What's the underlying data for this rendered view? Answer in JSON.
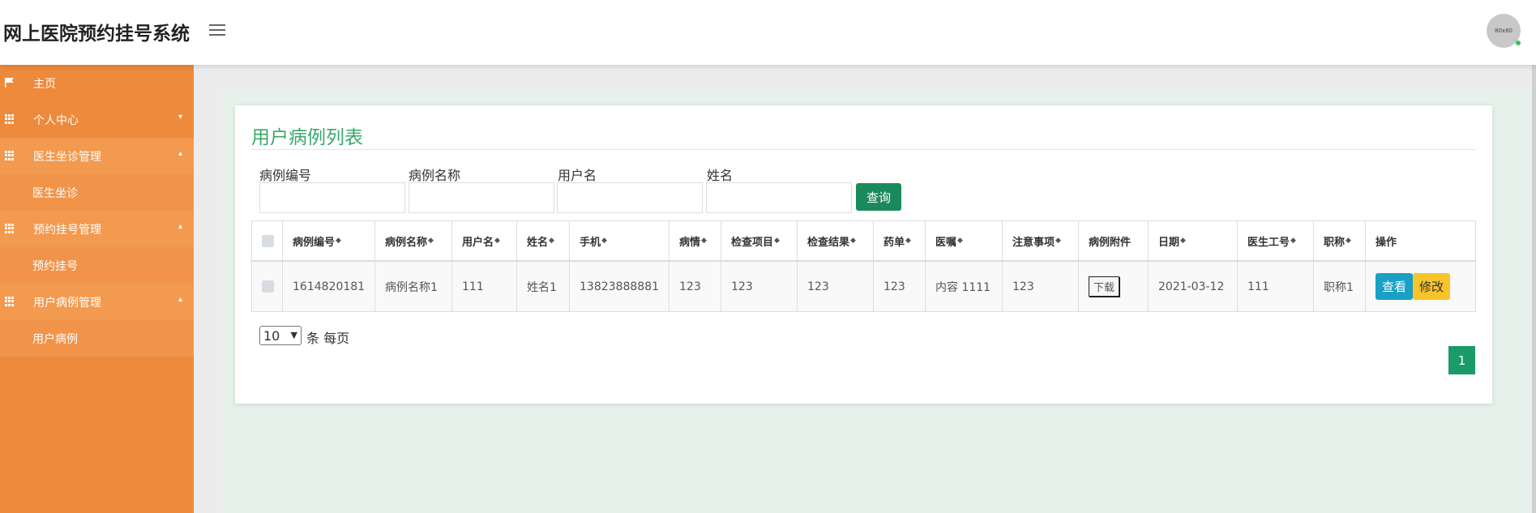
{
  "app": {
    "title": "网上医院预约挂号系统",
    "avatar_text": "80x80"
  },
  "sidebar": {
    "items": [
      {
        "label": "主页",
        "icon": "flag-icon"
      },
      {
        "label": "个人中心",
        "icon": "grid-icon"
      },
      {
        "label": "医生坐诊管理",
        "icon": "grid-icon"
      },
      {
        "label": "医生坐诊"
      },
      {
        "label": "预约挂号管理",
        "icon": "grid-icon"
      },
      {
        "label": "预约挂号"
      },
      {
        "label": "用户病例管理",
        "icon": "grid-icon"
      },
      {
        "label": "用户病例"
      }
    ]
  },
  "main": {
    "title": "用户病例列表",
    "filters": [
      {
        "label": "病例编号",
        "value": ""
      },
      {
        "label": "病例名称",
        "value": ""
      },
      {
        "label": "用户名",
        "value": ""
      },
      {
        "label": "姓名",
        "value": ""
      }
    ],
    "search_label": "查询",
    "table": {
      "columns": [
        "病例编号",
        "病例名称",
        "用户名",
        "姓名",
        "手机",
        "病情",
        "检查项目",
        "检查结果",
        "药单",
        "医嘱",
        "注意事项",
        "病例附件",
        "日期",
        "医生工号",
        "职称",
        "操作"
      ],
      "rows": [
        {
          "cells": [
            "1614820181",
            "病例名称1",
            "111",
            "姓名1",
            "13823888881",
            "123",
            "123",
            "123",
            "123",
            "内容 1111",
            "123",
            "",
            "2021-03-12",
            "111",
            "职称1"
          ],
          "download_label": "下载",
          "view_label": "查看",
          "edit_label": "修改"
        }
      ]
    },
    "pagination": {
      "page_size": "10",
      "per_page_text": "条 每页",
      "current_page": "1"
    }
  }
}
